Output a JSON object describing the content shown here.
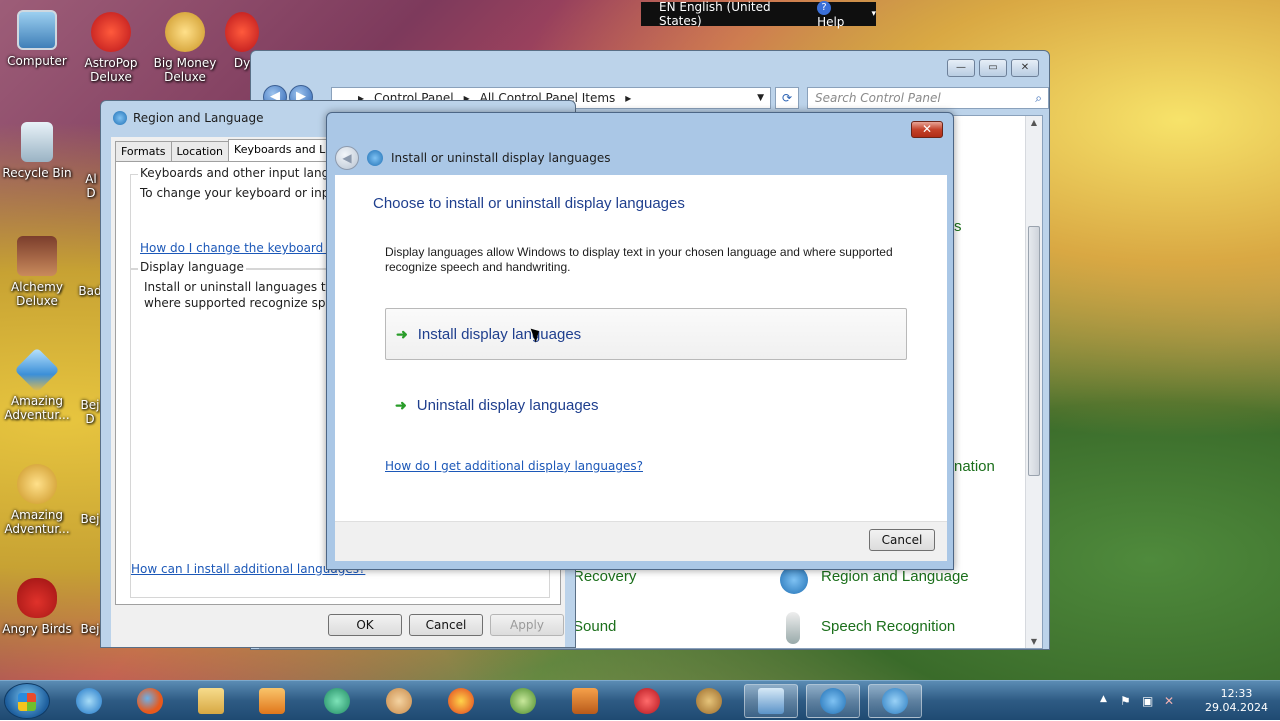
{
  "language_bar": {
    "language": "EN English (United States)",
    "help": "Help"
  },
  "desktop_icons": [
    {
      "label": "Computer"
    },
    {
      "label": "AstroPop Deluxe"
    },
    {
      "label": "Big Money Deluxe"
    },
    {
      "label": "Dy"
    },
    {
      "label": "Recycle Bin"
    },
    {
      "label": "Al D"
    },
    {
      "label": "Alchemy Deluxe"
    },
    {
      "label": "Bad"
    },
    {
      "label": "Amazing Adventur..."
    },
    {
      "label": "Bej D"
    },
    {
      "label": "Amazing Adventur..."
    },
    {
      "label": "Bej"
    },
    {
      "label": "Angry Birds"
    },
    {
      "label": "Bej"
    }
  ],
  "control_panel": {
    "breadcrumb": [
      "Control Panel",
      "All Control Panel Items"
    ],
    "search_placeholder": "Search Control Panel",
    "items": [
      {
        "label": "s"
      },
      {
        "label": "nation"
      },
      {
        "label": "Recovery"
      },
      {
        "label": "Region and Language"
      },
      {
        "label": "Sound"
      },
      {
        "label": "Speech Recognition"
      }
    ]
  },
  "region_language": {
    "title": "Region and Language",
    "tabs": [
      "Formats",
      "Location",
      "Keyboards and Langu"
    ],
    "keyboards_section": {
      "heading": "Keyboards and other input language",
      "text": "To change your keyboard or input l",
      "link": "How do I change the keyboard layo"
    },
    "display_section": {
      "heading": "Display language",
      "text_line1": "Install or uninstall languages that W",
      "text_line2": "where supported recognize speech"
    },
    "bottom_link": "How can I install additional languages?",
    "buttons": {
      "ok": "OK",
      "cancel": "Cancel",
      "apply": "Apply"
    }
  },
  "install_dialog": {
    "title": "Install or uninstall display languages",
    "heading": "Choose to install or uninstall display languages",
    "description": "Display languages allow Windows to display text in your chosen language and where supported recognize speech and handwriting.",
    "install_command": "Install display languages",
    "uninstall_command": "Uninstall display languages",
    "help_link": "How do I get additional display languages?",
    "cancel": "Cancel",
    "close_glyph": "✕"
  },
  "clock": {
    "time": "12:33",
    "date": "29.04.2024"
  },
  "colors": {
    "link": "#1c58b8",
    "command": "#1f3f8e",
    "cp_link": "#1b6f1b"
  }
}
